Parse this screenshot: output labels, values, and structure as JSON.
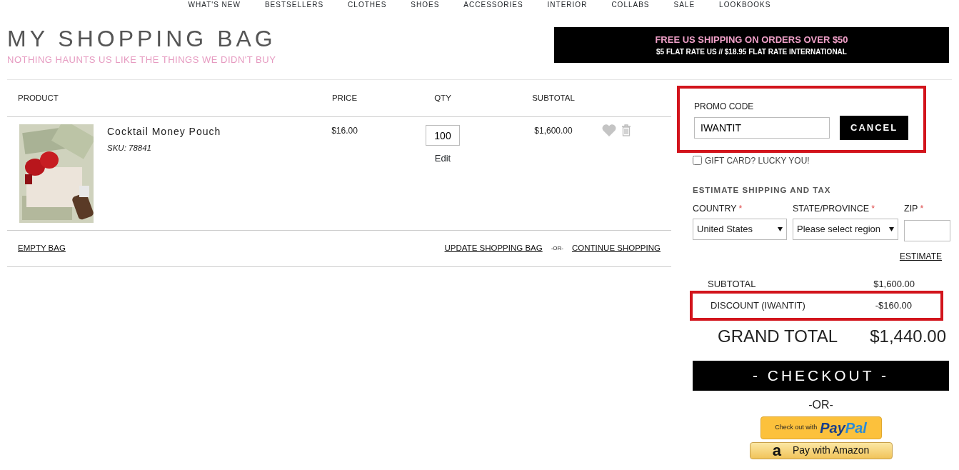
{
  "nav": [
    "WHAT'S NEW",
    "BESTSELLERS",
    "CLOTHES",
    "SHOES",
    "ACCESSORIES",
    "INTERIOR",
    "COLLABS",
    "SALE",
    "LOOKBOOKS"
  ],
  "header": {
    "title": "MY SHOPPING BAG",
    "tagline": "NOTHING HAUNTS US LIKE THE THINGS WE DIDN'T BUY"
  },
  "banner": {
    "headline": "FREE US SHIPPING ON ORDERS OVER $50",
    "subline": "$5 FLAT RATE US // $18.95 FLAT RATE INTERNATIONAL"
  },
  "table": {
    "columns": [
      "PRODUCT",
      "PRICE",
      "QTY",
      "SUBTOTAL"
    ],
    "rows": [
      {
        "name": "Cocktail Money Pouch",
        "sku": "SKU: 78841",
        "price": "$16.00",
        "qty": "100",
        "edit": "Edit",
        "subtotal": "$1,600.00"
      }
    ]
  },
  "actions": {
    "empty": "EMPTY BAG",
    "update": "UPDATE SHOPPING BAG",
    "or": "-OR-",
    "continue": "CONTINUE SHOPPING"
  },
  "promo": {
    "label": "PROMO CODE",
    "value": "IWANTIT",
    "button": "CANCEL",
    "highlighted": true
  },
  "gift_card": {
    "label": "GIFT CARD? LUCKY YOU!",
    "checked": false
  },
  "shipping": {
    "heading": "ESTIMATE SHIPPING AND TAX",
    "required_mark": "*",
    "fields": [
      {
        "kind": "select",
        "label": "COUNTRY",
        "value": "United States"
      },
      {
        "kind": "select",
        "label": "STATE/PROVINCE",
        "value": "Please select region"
      },
      {
        "kind": "text",
        "label": "ZIP"
      }
    ],
    "estimate": "ESTIMATE"
  },
  "totals": [
    {
      "label": "SUBTOTAL",
      "value": "$1,600.00",
      "highlighted": false
    },
    {
      "label": "DISCOUNT (IWANTIT)",
      "value": "-$160.00",
      "highlighted": true
    }
  ],
  "grand_total": {
    "label": "GRAND TOTAL",
    "value": "$1,440.00"
  },
  "checkout": "- CHECKOUT -",
  "or": "-OR-",
  "paypal": {
    "prefix": "Check out with",
    "brand_1": "Pay",
    "brand_2": "Pal"
  },
  "amazon": {
    "logo": "a",
    "label": "Pay with Amazon"
  }
}
